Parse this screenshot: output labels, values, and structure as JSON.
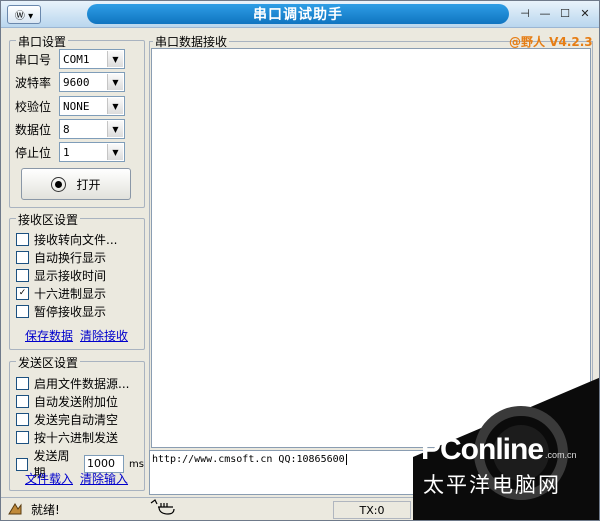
{
  "window": {
    "title": "串口调试助手",
    "version": "@野人 V4.2.3"
  },
  "serial": {
    "group_title": "串口设置",
    "port_label": "串口号",
    "port_value": "COM1",
    "baud_label": "波特率",
    "baud_value": "9600",
    "parity_label": "校验位",
    "parity_value": "NONE",
    "databits_label": "数据位",
    "databits_value": "8",
    "stopbits_label": "停止位",
    "stopbits_value": "1",
    "open_label": "打开"
  },
  "receive": {
    "group_title": "接收区设置",
    "options": [
      {
        "label": "接收转向文件...",
        "checked": false
      },
      {
        "label": "自动换行显示",
        "checked": false
      },
      {
        "label": "显示接收时间",
        "checked": false
      },
      {
        "label": "十六进制显示",
        "checked": true
      },
      {
        "label": "暂停接收显示",
        "checked": false
      }
    ],
    "save_link": "保存数据",
    "clear_link": "清除接收",
    "area_title": "串口数据接收"
  },
  "send": {
    "group_title": "发送区设置",
    "options": [
      {
        "label": "启用文件数据源...",
        "checked": false
      },
      {
        "label": "自动发送附加位",
        "checked": false
      },
      {
        "label": "发送完自动清空",
        "checked": false
      },
      {
        "label": "按十六进制发送",
        "checked": false
      }
    ],
    "period_label": "发送周期",
    "period_value": "1000",
    "period_unit": "ms",
    "load_link": "文件载入",
    "clear_link": "清除输入",
    "text": "http://www.cmsoft.cn QQ:10865600"
  },
  "status": {
    "ready": "就绪!",
    "tx": "TX:0"
  },
  "watermark": {
    "brand": "PConline",
    "domain": ".com.cn",
    "slogan": "太平洋电脑网"
  },
  "colors": {
    "title_blue": "#1180cf",
    "version_orange": "#e67d14",
    "link_blue": "#0000cc"
  }
}
